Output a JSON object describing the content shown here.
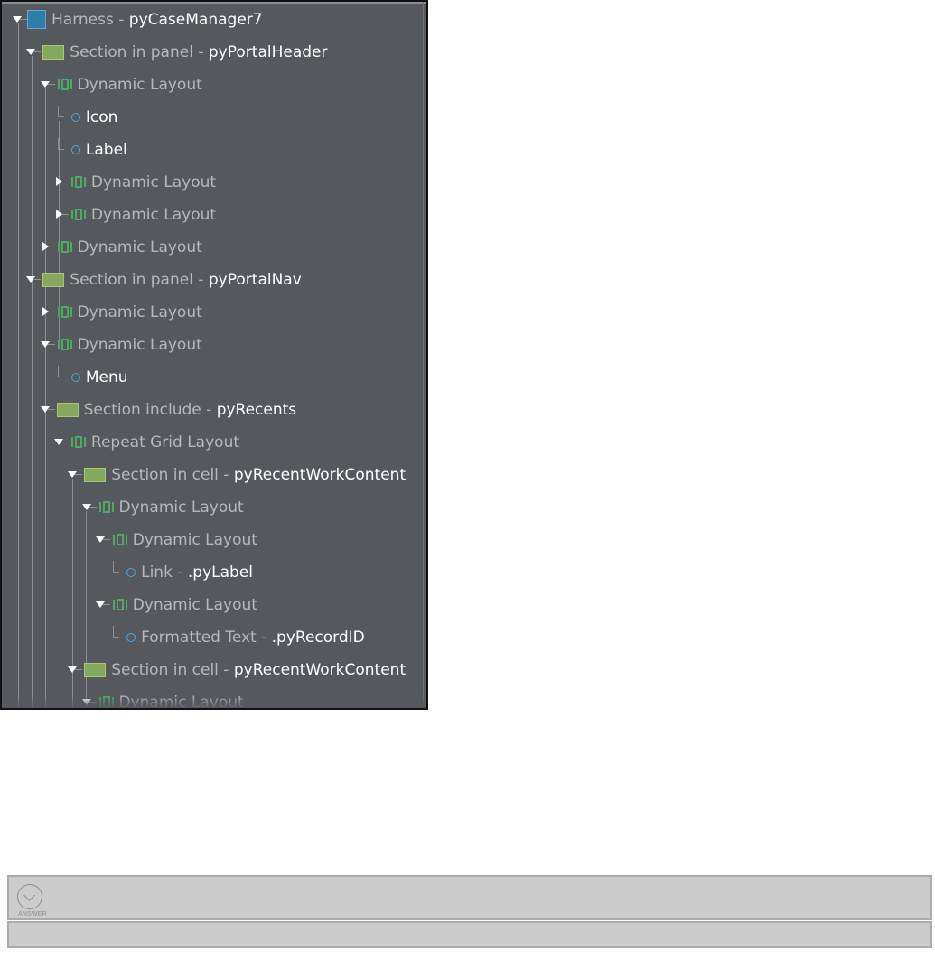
{
  "tree": [
    {
      "kind": "harness",
      "type": "Harness",
      "name": "pyCaseManager7",
      "expanded": true
    },
    {
      "kind": "section",
      "type": "Section in panel",
      "name": "pyPortalHeader",
      "expanded": true
    },
    {
      "kind": "dynamic",
      "type": "Dynamic Layout",
      "name": "",
      "expanded": true
    },
    {
      "kind": "field",
      "type": "",
      "name": "Icon"
    },
    {
      "kind": "field",
      "type": "",
      "name": "Label"
    },
    {
      "kind": "dynamic",
      "type": "Dynamic Layout",
      "name": "",
      "expanded": false
    },
    {
      "kind": "dynamic",
      "type": "Dynamic Layout",
      "name": "",
      "expanded": false
    },
    {
      "kind": "dynamic",
      "type": "Dynamic Layout",
      "name": "",
      "expanded": false
    },
    {
      "kind": "section",
      "type": "Section in panel",
      "name": "pyPortalNav",
      "expanded": true
    },
    {
      "kind": "dynamic",
      "type": "Dynamic Layout",
      "name": "",
      "expanded": false
    },
    {
      "kind": "dynamic",
      "type": "Dynamic Layout",
      "name": "",
      "expanded": true
    },
    {
      "kind": "field",
      "type": "",
      "name": "Menu"
    },
    {
      "kind": "section",
      "type": "Section include",
      "name": "pyRecents",
      "expanded": true
    },
    {
      "kind": "dynamic",
      "type": "Repeat Grid Layout",
      "name": "",
      "expanded": true
    },
    {
      "kind": "section",
      "type": "Section in cell",
      "name": "pyRecentWorkContent",
      "expanded": true
    },
    {
      "kind": "dynamic",
      "type": "Dynamic Layout",
      "name": "",
      "expanded": true
    },
    {
      "kind": "dynamic",
      "type": "Dynamic Layout",
      "name": "",
      "expanded": true
    },
    {
      "kind": "field",
      "type": "Link",
      "name": ".pyLabel"
    },
    {
      "kind": "dynamic",
      "type": "Dynamic Layout",
      "name": "",
      "expanded": true
    },
    {
      "kind": "field",
      "type": "Formatted Text",
      "name": ".pyRecordID"
    },
    {
      "kind": "section",
      "type": "Section in cell",
      "name": "pyRecentWorkContent",
      "expanded": true
    },
    {
      "kind": "dynamic",
      "type": "Dynamic Layout",
      "name": "",
      "expanded": true
    }
  ],
  "answer": {
    "label": "ANSWER",
    "icon": "chevron-down-circle-icon"
  },
  "colors": {
    "panel_bg": "#55585c",
    "label_type": "#b5b8bc",
    "label_name": "#ffffff",
    "harness_icon": "#2f7dab",
    "section_icon": "#86a85d",
    "dynamic_icon": "#4fa866",
    "field_icon": "#4aa9e0",
    "answer_bg": "#cccccc"
  }
}
